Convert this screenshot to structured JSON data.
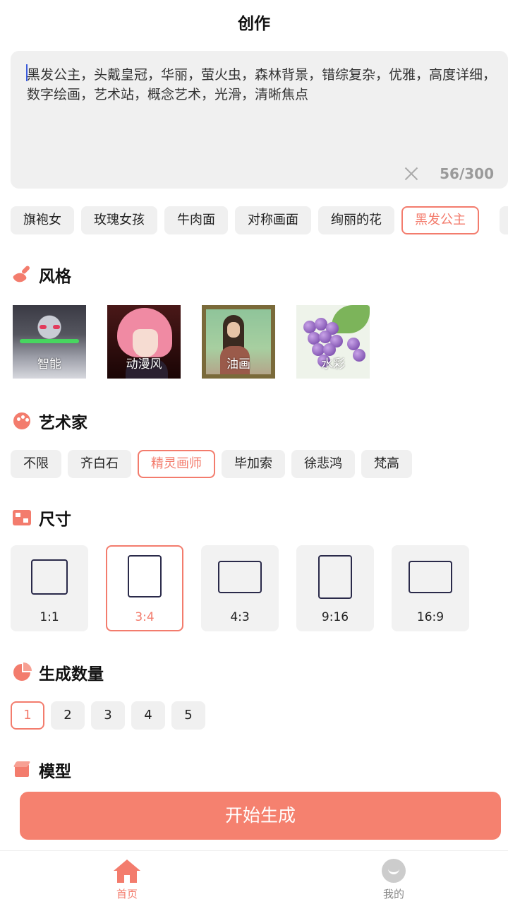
{
  "header": {
    "title": "创作"
  },
  "prompt": {
    "text": "黑发公主，头戴皇冠，华丽，萤火虫，森林背景，错综复杂，优雅，高度详细，数字绘画，艺术站，概念艺术，光滑，清晰焦点",
    "count": "56/300"
  },
  "tags": [
    {
      "label": "旗袍女",
      "selected": false
    },
    {
      "label": "玫瑰女孩",
      "selected": false
    },
    {
      "label": "牛肉面",
      "selected": false
    },
    {
      "label": "对称画面",
      "selected": false
    },
    {
      "label": "绚丽的花",
      "selected": false
    },
    {
      "label": "黑发公主",
      "selected": true
    }
  ],
  "style_section": {
    "title": "风格",
    "items": [
      {
        "label": "智能"
      },
      {
        "label": "动漫风"
      },
      {
        "label": "油画"
      },
      {
        "label": "水彩"
      }
    ]
  },
  "artist_section": {
    "title": "艺术家",
    "items": [
      {
        "label": "不限",
        "selected": false
      },
      {
        "label": "齐白石",
        "selected": false
      },
      {
        "label": "精灵画师",
        "selected": true
      },
      {
        "label": "毕加索",
        "selected": false
      },
      {
        "label": "徐悲鸿",
        "selected": false
      },
      {
        "label": "梵高",
        "selected": false
      }
    ]
  },
  "size_section": {
    "title": "尺寸",
    "items": [
      {
        "label": "1:1",
        "selected": false
      },
      {
        "label": "3:4",
        "selected": true
      },
      {
        "label": "4:3",
        "selected": false
      },
      {
        "label": "9:16",
        "selected": false
      },
      {
        "label": "16:9",
        "selected": false
      }
    ]
  },
  "count_section": {
    "title": "生成数量",
    "items": [
      {
        "label": "1",
        "selected": true
      },
      {
        "label": "2",
        "selected": false
      },
      {
        "label": "3",
        "selected": false
      },
      {
        "label": "4",
        "selected": false
      },
      {
        "label": "5",
        "selected": false
      }
    ]
  },
  "model_section": {
    "title": "模型"
  },
  "generate_label": "开始生成",
  "nav": {
    "home": {
      "label": "首页",
      "active": true
    },
    "mine": {
      "label": "我的",
      "active": false
    }
  },
  "colors": {
    "accent": "#f37c6d",
    "button": "#f5816f",
    "chip_bg": "#f0f0f0"
  },
  "icons": {
    "style": "paintbrush-icon",
    "artist": "palette-icon",
    "size": "image-size-icon",
    "count": "pie-chart-icon",
    "model": "cube-icon",
    "clear": "close-icon",
    "home": "home-icon",
    "mine": "smile-face-icon"
  }
}
